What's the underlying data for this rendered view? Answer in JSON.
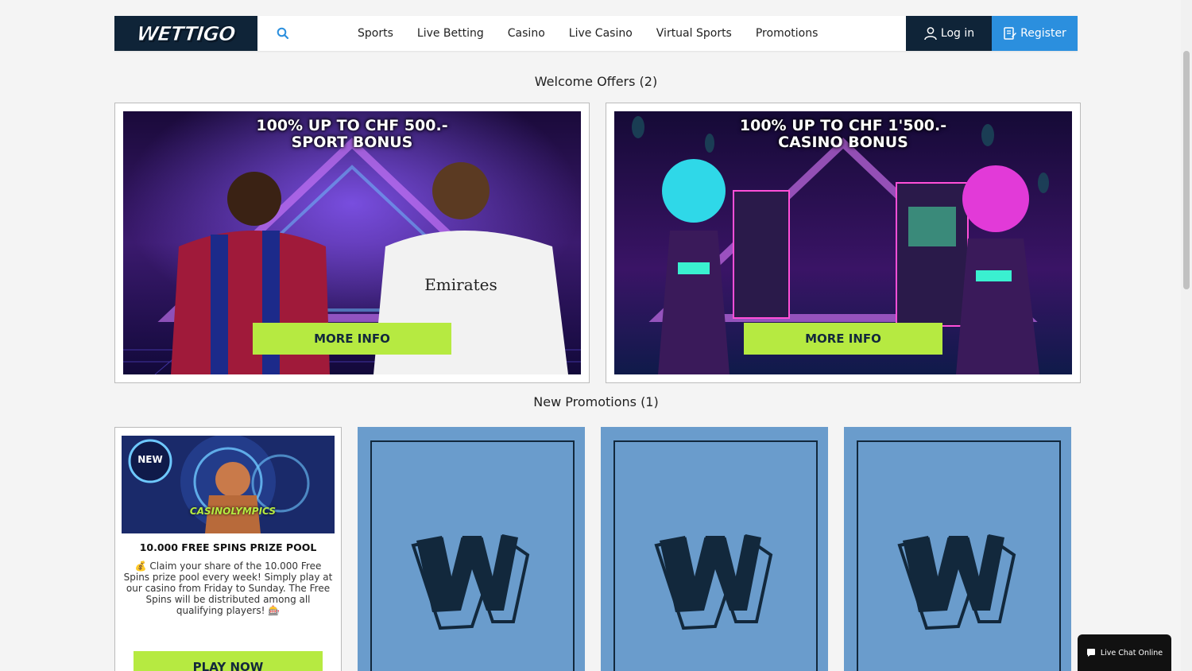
{
  "header": {
    "logo": "WETTIGO",
    "search_icon": "search-icon",
    "nav": [
      "Sports",
      "Live Betting",
      "Casino",
      "Live Casino",
      "Virtual Sports",
      "Promotions"
    ],
    "login_label": "Log in",
    "register_label": "Register"
  },
  "welcome": {
    "title": "Welcome Offers (2)",
    "offers": [
      {
        "title_line1": "100% UP TO CHF 500.-",
        "title_line2": "SPORT BONUS",
        "button": "MORE INFO"
      },
      {
        "title_line1": "100% UP TO CHF 1'500.-",
        "title_line2": "CASINO BONUS",
        "button": "MORE INFO"
      }
    ]
  },
  "promotions": {
    "title": "New Promotions (1)",
    "card": {
      "badge": "NEW",
      "image_caption": "CASINOLYMPICS",
      "title": "10.000 FREE SPINS PRIZE POOL",
      "description": "💰 Claim your share of the 10.000 Free Spins prize pool every week! Simply play at our casino from Friday to Sunday. The Free Spins will be distributed among all qualifying players! 🎰",
      "button": "PLAY NOW"
    }
  },
  "chat": {
    "label": "Live Chat Online"
  },
  "colors": {
    "navy": "#0f2438",
    "blue": "#2b8fde",
    "lime": "#b6ea41",
    "placeholder": "#6a9ccc"
  }
}
